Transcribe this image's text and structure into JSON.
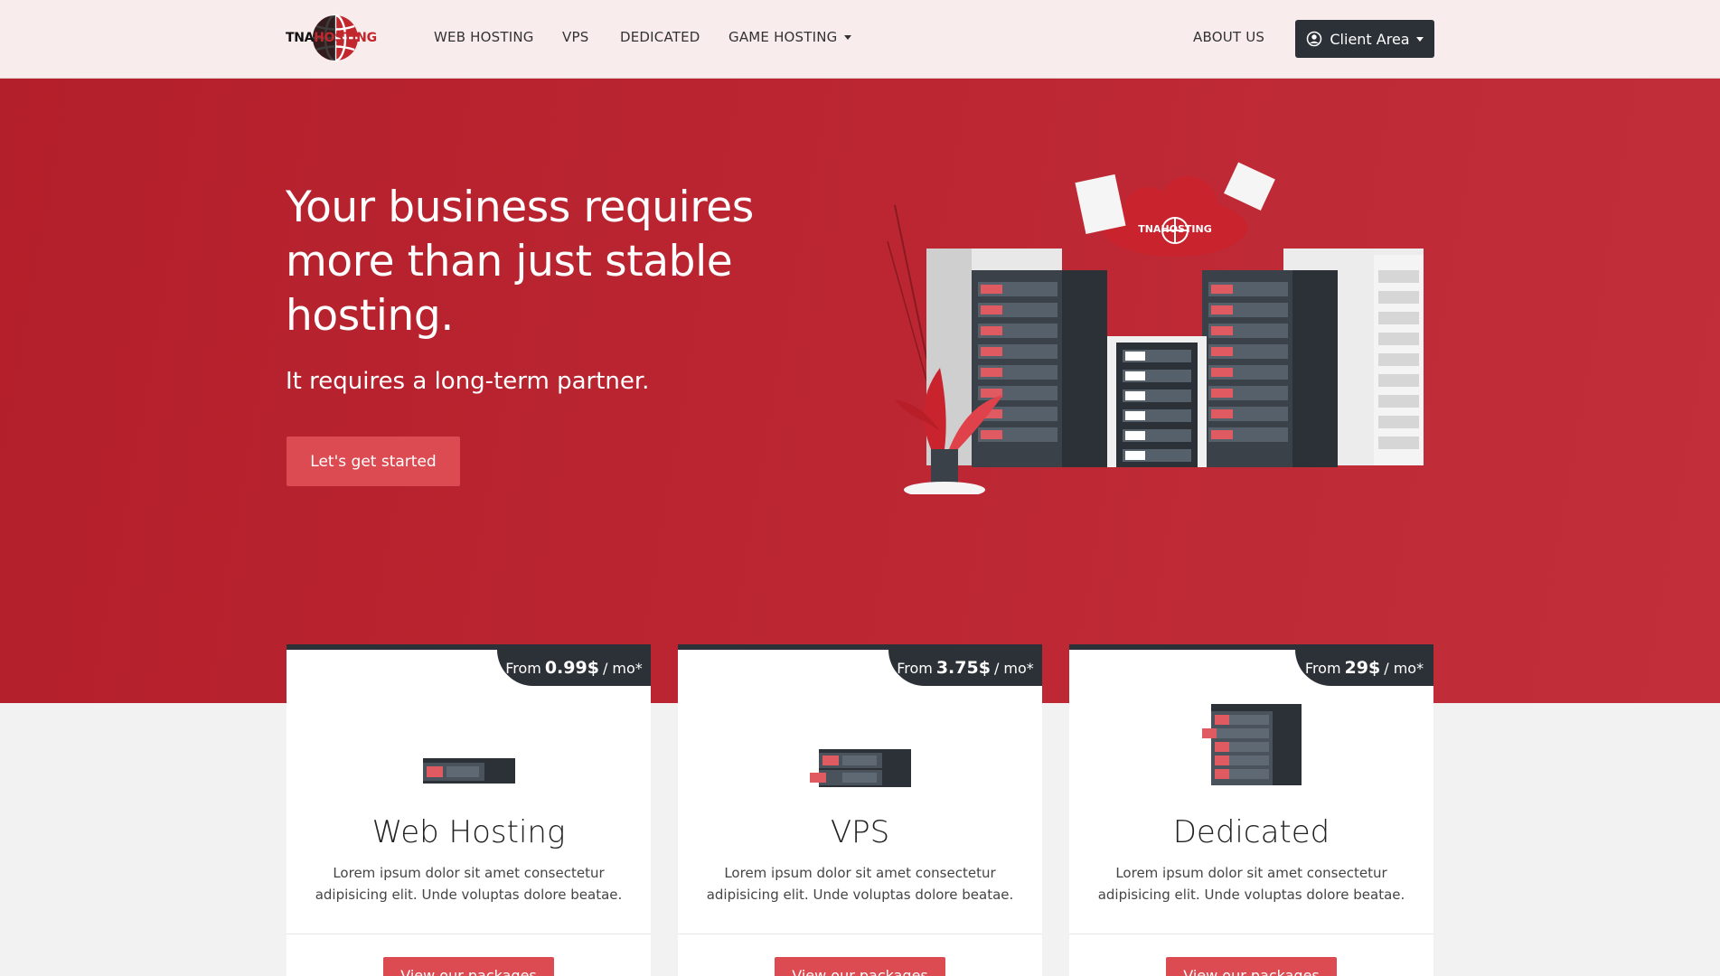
{
  "brand": {
    "part1": "TNA",
    "part2": "HOSTING",
    "cloud_label": "TNAHOSTING"
  },
  "nav": {
    "items": [
      {
        "label": "WEB HOSTING"
      },
      {
        "label": "VPS"
      },
      {
        "label": "DEDICATED"
      },
      {
        "label": "GAME HOSTING"
      }
    ],
    "about": "ABOUT US",
    "client_area": "Client Area"
  },
  "hero": {
    "title": "Your business requires more than just stable hosting.",
    "subtitle": "It requires a long-term partner.",
    "cta": "Let's get started"
  },
  "cards": [
    {
      "price_prefix": "From",
      "price": "0.99$",
      "price_suffix": "/ mo*",
      "title": "Web Hosting",
      "description": "Lorem ipsum dolor sit amet consectetur adipisicing elit. Unde voluptas dolore beatae.",
      "button": "View our packages",
      "icon": "server-icon"
    },
    {
      "price_prefix": "From",
      "price": "3.75$",
      "price_suffix": "/ mo*",
      "title": "VPS",
      "description": "Lorem ipsum dolor sit amet consectetur adipisicing elit. Unde voluptas dolore beatae.",
      "button": "View our packages",
      "icon": "vps-server-icon"
    },
    {
      "price_prefix": "From",
      "price": "29$",
      "price_suffix": "/ mo*",
      "title": "Dedicated",
      "description": "Lorem ipsum dolor sit amet consectetur adipisicing elit. Unde voluptas dolore beatae.",
      "button": "View our packages",
      "icon": "dedicated-server-icon"
    }
  ],
  "colors": {
    "primary": "#c1272d",
    "hero_bg": "#b91f2b",
    "dark": "#2c3137",
    "button": "#dc4a52",
    "navbar_bg": "#f8eced"
  }
}
